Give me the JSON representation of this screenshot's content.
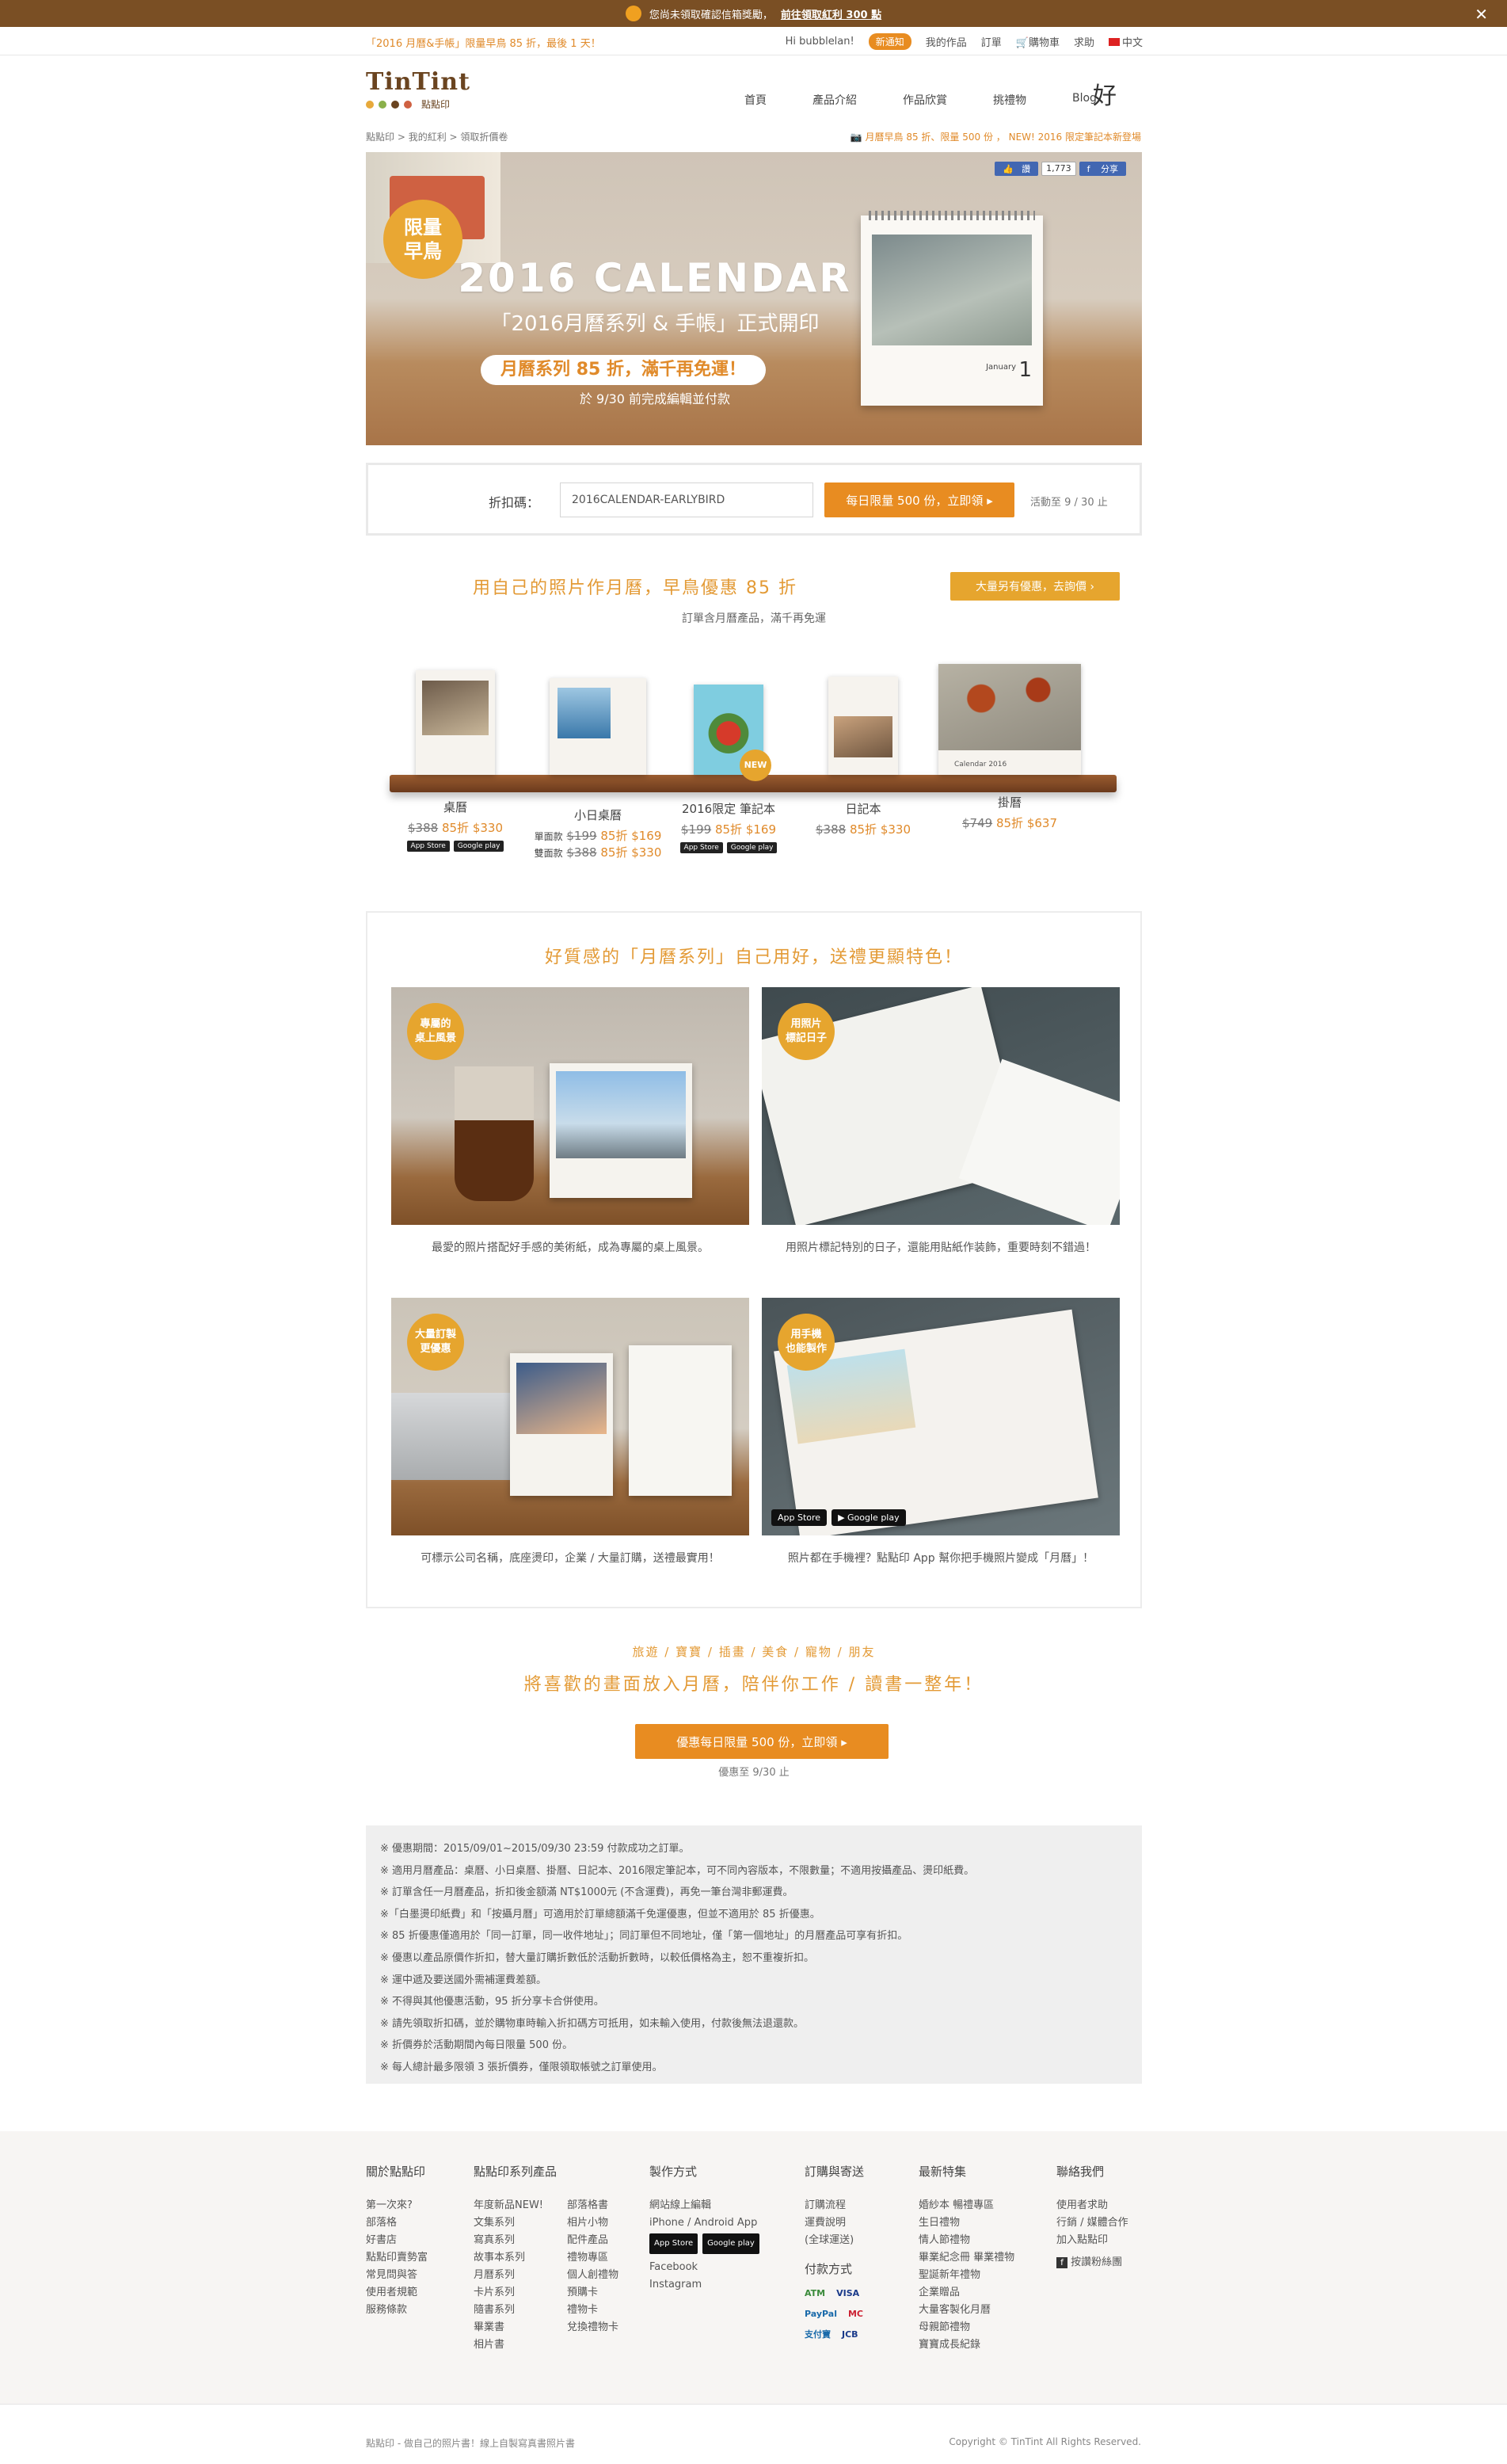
{
  "topbar": {
    "text": "您尚未領取確認信箱獎勵，",
    "link": "前往領取紅利 300 點",
    "close": "✕"
  },
  "header": {
    "promo": "「2016 月曆&手帳」限量早鳥 85 折，最後 1 天！",
    "greeting": "Hi bubblelan!",
    "notice_badge": "新通知",
    "links": [
      "我的作品",
      "訂單",
      "購物車",
      "求助",
      "中文"
    ],
    "logo": "TinTint",
    "logo_sub": "點點印",
    "nav": [
      "首頁",
      "產品介紹",
      "作品欣賞",
      "挑禮物",
      "Blog"
    ],
    "good_store": "好",
    "breadcrumb": [
      "點點印",
      "我的紅利",
      "領取折價卷"
    ],
    "news": "月曆早鳥 85 折、限量 500 份 ， NEW! 2016 限定筆記本新登場"
  },
  "hero": {
    "seal": [
      "限量",
      "早鳥"
    ],
    "title": "2016 CALENDAR",
    "subtitle": "「2016月曆系列 & 手帳」正式開印",
    "pill": "月曆系列 85 折，滿千再免運！",
    "note": "於 9/30 前完成編輯並付款",
    "cal_month": "January",
    "cal_day": "1",
    "share": [
      "讚",
      "1,773",
      "分享"
    ]
  },
  "discount": {
    "label": "折扣碼：",
    "code": "2016CALENDAR-EARLYBIRD",
    "button": "每日限量 500 份，立即領 ▸",
    "until": "活動至 9 / 30 止"
  },
  "section1": {
    "title": "用自己的照片作月曆，早鳥優惠 85 折",
    "bulk_button": "大量另有優惠，去詢價 ›",
    "sub": "訂單含月曆產品，滿千再免運",
    "products": [
      {
        "name": "桌曆",
        "lines": [
          {
            "old": "$388",
            "new": "85折 $330"
          }
        ],
        "stores": true
      },
      {
        "name": "小日桌曆",
        "lines": [
          {
            "pre": "單面款",
            "old": "$199",
            "new": "85折 $169"
          },
          {
            "pre": "雙面款",
            "old": "$388",
            "new": "85折 $330"
          }
        ],
        "stores": false
      },
      {
        "name": "2016限定 筆記本",
        "lines": [
          {
            "old": "$199",
            "new": "85折 $169"
          }
        ],
        "stores": true,
        "badge": "NEW"
      },
      {
        "name": "日記本",
        "lines": [
          {
            "old": "$388",
            "new": "85折 $330"
          }
        ],
        "stores": false
      },
      {
        "name": "掛曆",
        "lines": [
          {
            "old": "$749",
            "new": "85折 $637"
          }
        ],
        "stores": false,
        "cal_label": "Calendar 2016"
      }
    ],
    "store_labels": [
      "App Store",
      "Google play"
    ]
  },
  "features": {
    "title": "好質感的「月曆系列」自己用好，送禮更顯特色！",
    "items": [
      {
        "badge": [
          "專屬的",
          "桌上風景"
        ],
        "caption": "最愛的照片搭配好手感的美術紙，成為專屬的桌上風景。"
      },
      {
        "badge": [
          "用照片",
          "標記日子"
        ],
        "caption": "用照片標記特別的日子，還能用貼紙作装飾，重要時刻不錯過！"
      },
      {
        "badge": [
          "大量訂製",
          "更優惠"
        ],
        "caption": "可標示公司名稱，底座燙印，企業 / 大量訂購，送禮最實用！"
      },
      {
        "badge": [
          "用手機",
          "也能製作"
        ],
        "caption": "照片都在手機裡？點點印 App 幫你把手機照片變成「月曆」！"
      }
    ],
    "app_labels": [
      "App Store",
      "Google play"
    ]
  },
  "section3": {
    "tags": "旅遊 / 寶寶 / 插畫 / 美食 / 寵物 / 朋友",
    "slogan": "將喜歡的畫面放入月曆，陪伴你工作 / 讀書一整年！",
    "button": "優惠每日限量 500 份，立即領 ▸",
    "until": "優惠至 9/30 止"
  },
  "notes": [
    "※ 優惠期間：2015/09/01~2015/09/30 23:59 付款成功之訂單。",
    "※ 適用月曆產品：桌曆、小日桌曆、掛曆、日記本、2016限定筆記本，可不同內容版本，不限數量；不適用按攝產品、燙印紙費。",
    "※ 訂單含任一月曆產品，折扣後金額滿 NT$1000元 (不含運費)，再免一筆台灣非郵運費。",
    "※「白墨燙印紙費」和「按攝月曆」可適用於訂單總額滿千免運優惠，但並不適用於 85 折優惠。",
    "※ 85 折優惠僅適用於「同一訂單，同一收件地址」；同訂單但不同地址，僅「第一個地址」的月曆產品可享有折扣。",
    "※ 優惠以產品原價作折扣，替大量訂購折數低於活動折數時，以較低價格為主，恕不重複折扣。",
    "※ 運中遞及要送國外需補運費差額。",
    "※ 不得與其他優惠活動，95 折分享卡合併使用。",
    "※ 請先領取折扣碼，並於購物車時輸入折扣碼方可抵用，如未輸入使用，付款後無法退還款。",
    "※ 折價券於活動期間內每日限量 500 份。",
    "※ 每人總計最多限領 3 張折價券，僅限領取帳號之訂單使用。"
  ],
  "footer": {
    "cols": [
      {
        "title": "關於點點印",
        "items": [
          "第一次來?",
          "部落格",
          "好書店",
          "點點印賣勢富",
          "常見問與答",
          "使用者規範",
          "服務條款"
        ]
      },
      {
        "title": "點點印系列產品",
        "a": [
          "年度新品NEW!",
          "文集系列",
          "寫真系列",
          "故事本系列",
          "月曆系列",
          "卡片系列",
          "隨書系列",
          "畢業書",
          "相片書"
        ],
        "b": [
          "部落格書",
          "相片小物",
          "配件產品",
          "禮物專區",
          "個人創禮物",
          "預購卡",
          "禮物卡",
          "兌換禮物卡"
        ]
      },
      {
        "title": "製作方式",
        "items": [
          "網站線上編輯",
          "iPhone / Android App",
          "",
          "Facebook",
          "Instagram"
        ],
        "stores": [
          "App Store",
          "Google play"
        ]
      },
      {
        "title": "訂購與寄送",
        "items": [
          "訂購流程",
          "運費說明",
          "(全球運送)"
        ],
        "title2": "付款方式",
        "pay": [
          [
            "ATM",
            "VISA"
          ],
          [
            "PayPal",
            "MC"
          ],
          [
            "支付寶",
            "JCB"
          ]
        ]
      },
      {
        "title": "最新特集",
        "items": [
          "婚紗本 暢禮專區",
          "生日禮物",
          "情人節禮物",
          "畢業紀念冊 畢業禮物",
          "聖誕新年禮物",
          "企業贈品",
          "大量客製化月曆",
          "母親節禮物",
          "寶寶成長紀錄"
        ]
      },
      {
        "title": "聯絡我們",
        "items": [
          "使用者求助",
          "行銷 / 媒體合作",
          "加入點點印"
        ],
        "fb": "按讚粉絲團"
      }
    ],
    "copy_left": "點點印 - 做自己的照片書！線上自製寫真書照片書",
    "copy_right": "Copyright © TinTint All Rights Reserved."
  },
  "colors": {
    "accent": "#e88c21",
    "gold": "#e6a52e",
    "brown": "#7a4f24"
  }
}
